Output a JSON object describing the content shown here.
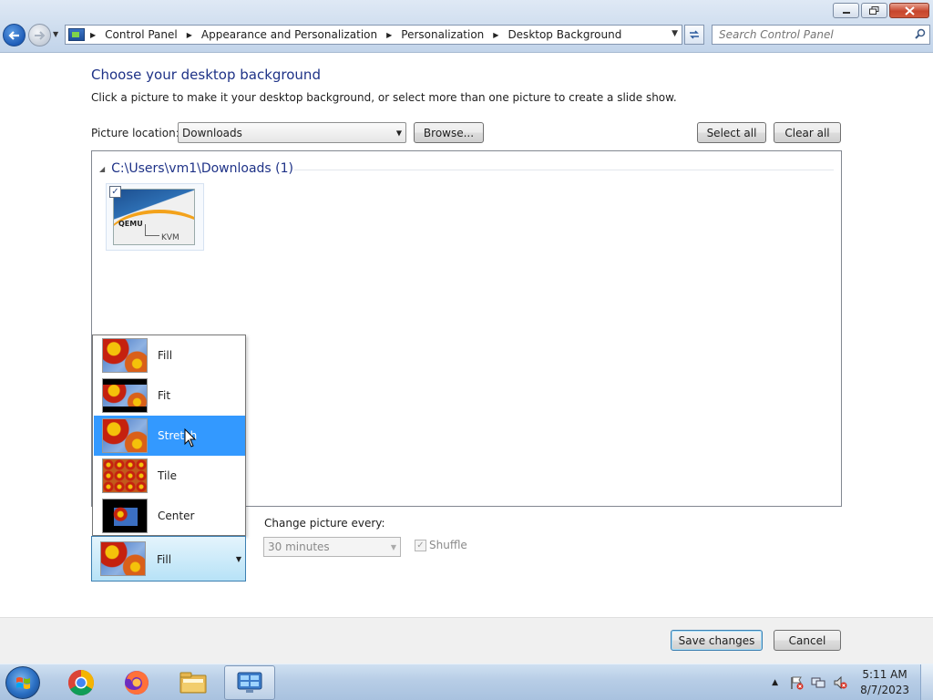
{
  "window": {
    "minimize_label": "▭",
    "maximize_label": "⧉",
    "close_label": "✕"
  },
  "address_bar": {
    "breadcrumbs": [
      "Control Panel",
      "Appearance and Personalization",
      "Personalization",
      "Desktop Background"
    ],
    "search_placeholder": "Search Control Panel"
  },
  "page": {
    "title": "Choose your desktop background",
    "subtitle": "Click a picture to make it your desktop background, or select more than one picture to create a slide show.",
    "picture_location_label": "Picture location:",
    "picture_location_value": "Downloads",
    "browse_label": "Browse...",
    "select_all_label": "Select all",
    "clear_all_label": "Clear all",
    "group_header": "C:\\Users\\vm1\\Downloads (1)",
    "thumbnail": {
      "checked": true,
      "logo_left": "QEMU",
      "logo_right": "KVM"
    }
  },
  "position": {
    "options": [
      "Fill",
      "Fit",
      "Stretch",
      "Tile",
      "Center"
    ],
    "highlighted": "Stretch",
    "selected": "Fill"
  },
  "slideshow": {
    "change_label": "Change picture every:",
    "interval_value": "30 minutes",
    "shuffle_label": "Shuffle",
    "shuffle_checked": true
  },
  "footer": {
    "save_label": "Save changes",
    "cancel_label": "Cancel"
  },
  "taskbar": {
    "time": "5:11 AM",
    "date": "8/7/2023",
    "pinned": [
      "chrome-icon",
      "firefox-icon",
      "file-explorer-icon",
      "control-panel-icon"
    ]
  },
  "colors": {
    "title_blue": "#1e3287",
    "selection_blue": "#3399ff",
    "combo_hover": "#b7e2f7"
  }
}
